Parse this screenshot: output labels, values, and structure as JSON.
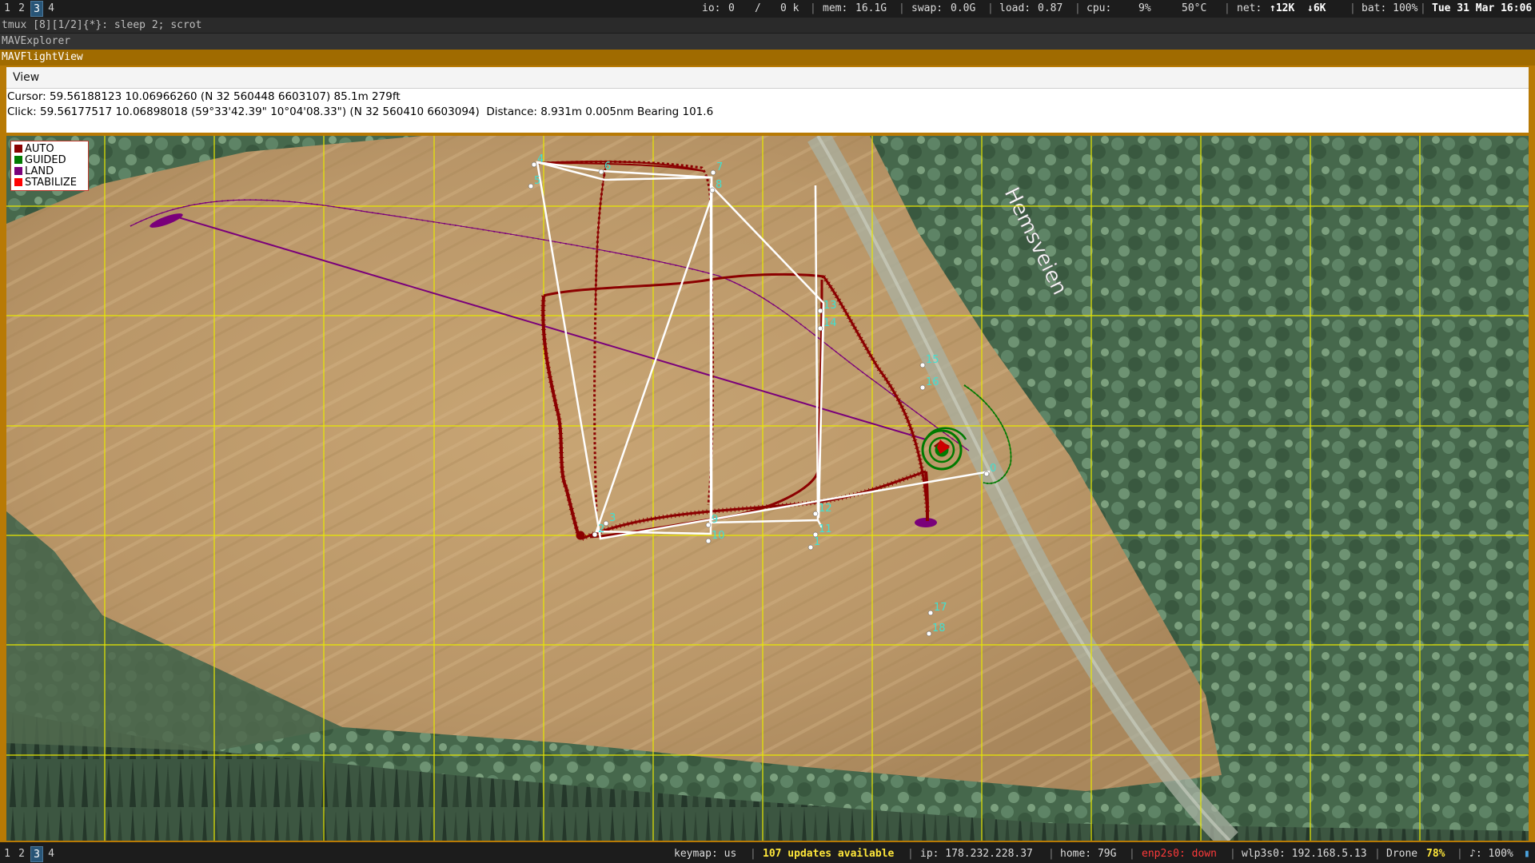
{
  "workspaces": [
    "1",
    "2",
    "3",
    "4"
  ],
  "active_workspace": "3",
  "status": {
    "io_label": "io:",
    "io_read": "0",
    "io_slash": "/",
    "io_write": "0 k",
    "mem_label": "mem:",
    "mem": "16.1G",
    "swap_label": "swap:",
    "swap": "0.0G",
    "load_label": "load:",
    "load": "0.87",
    "cpu_label": "cpu:",
    "cpu": "9%",
    "temp": "50°C",
    "net_label": "net:",
    "net_up": "↑12K",
    "net_down": "↓6K",
    "bat": "bat: 100%",
    "datetime": "Tue 31 Mar 16:06"
  },
  "tmux_line": "tmux [8][1/2]{*}:  sleep 2; scrot",
  "window_titles": {
    "inactive": "MAVExplorer",
    "active": "MAVFlightView"
  },
  "menu": {
    "view": "View"
  },
  "info": {
    "cursor": "Cursor: 59.56188123 10.06966260 (N 32 560448 6603107) 85.1m 279ft",
    "click": "Click: 59.56177517 10.06898018 (59°33'42.39\" 10°04'08.33\") (N 32 560410 6603094)  Distance: 8.931m 0.005nm Bearing 101.6"
  },
  "legend": [
    {
      "label": "AUTO",
      "color": "#8b0000"
    },
    {
      "label": "GUIDED",
      "color": "#007a00"
    },
    {
      "label": "LAND",
      "color": "#7a007a"
    },
    {
      "label": "STABILIZE",
      "color": "#ff0000"
    }
  ],
  "map": {
    "road_label": "Hemsveien",
    "grid_color": "#e8e800",
    "waypoint_color": "#40e0d0",
    "waypoints": [
      "0",
      "1",
      "2",
      "3",
      "4",
      "5",
      "6",
      "7",
      "8",
      "9",
      "10",
      "11",
      "12",
      "13",
      "14",
      "15",
      "16",
      "17",
      "18"
    ]
  },
  "bottom": {
    "keymap": "keymap: us",
    "updates": "107 updates available",
    "ip": "ip: 178.232.228.37",
    "home": "home: 79G",
    "eth": "enp2s0: down",
    "wlan": "wlp3s0: 192.168.5.13",
    "ssid": "Drone",
    "signal": "78%",
    "volume": "♪: 100%"
  }
}
